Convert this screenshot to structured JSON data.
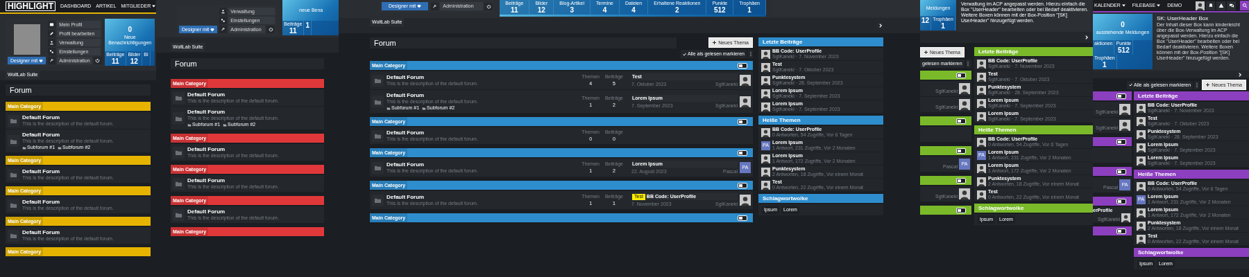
{
  "panels": [
    {
      "kind": "left",
      "color": "#e6b400",
      "header": {
        "logo": "HIGHLIGHT",
        "nav": [
          {
            "label": "DASHBOARD",
            "dropdown": false
          },
          {
            "label": "ARTIKEL",
            "dropdown": false
          },
          {
            "label": "MITGLIEDER",
            "dropdown": true
          }
        ]
      },
      "user": {
        "button": "Designer mit",
        "menu": [
          {
            "label": "Mein Profil",
            "kind": "profile"
          },
          {
            "label": "Profil bearbeiten",
            "kind": "edit"
          },
          {
            "label": "Verwaltung",
            "kind": "account"
          },
          {
            "label": "Einstellungen",
            "kind": "settings"
          },
          {
            "label": "Administration",
            "kind": "admin"
          }
        ]
      },
      "stats": {
        "counter": "0",
        "counter_label": "Neue Benachrichtigungen",
        "items": [
          {
            "label": "Beiträge",
            "value": "11"
          },
          {
            "label": "Bilder",
            "value": "12"
          },
          {
            "label": "Bl"
          }
        ]
      },
      "breadcrumb": "WoltLab Suite",
      "title": "Forum",
      "categories": [
        {
          "title": "Main Category",
          "forums": [
            {
              "kind": "full",
              "title": "Default Forum",
              "description": "This is the description of the default forum."
            },
            {
              "kind": "full",
              "title": "Default Forum",
              "description": "This is the description of the default forum.",
              "subforums": [
                "Subforum #1",
                "Subforum #2"
              ]
            }
          ]
        },
        {
          "title": "Main Category",
          "forums": [
            {
              "kind": "full",
              "title": "Default Forum",
              "description": "This is the description of the default forum."
            }
          ]
        },
        {
          "title": "Main Category",
          "forums": [
            {
              "kind": "full",
              "title": "Default Forum",
              "description": "This is the description of the default forum."
            }
          ]
        },
        {
          "title": "Main Category",
          "forums": [
            {
              "kind": "full",
              "title": "Default Forum",
              "description": "This is the description of the default forum."
            }
          ]
        },
        {
          "title": "Main Category"
        }
      ]
    },
    {
      "kind": "second",
      "color": "#e0383a",
      "user": {
        "button": "Designer mit",
        "menu": [
          {
            "label": "Verwaltung",
            "kind": "account"
          },
          {
            "label": "Einstellungen",
            "kind": "settings"
          },
          {
            "label": "Administration",
            "kind": "admin"
          }
        ]
      },
      "stats": {
        "counter_label": "neue Bena",
        "items": [
          {
            "label": "Beiträge",
            "value": "11"
          },
          {
            "value": "1"
          }
        ]
      },
      "breadcrumb": "WoltLab Suite",
      "title": "Forum",
      "categories": [
        {
          "title": "Main Category",
          "forums": [
            {
              "kind": "full",
              "title": "Default Forum",
              "description": "This is the description of the default forum."
            },
            {
              "kind": "full",
              "title": "Default Forum",
              "description": "This is the description of the default forum.",
              "subforums": [
                "Subforum #1",
                "Subforum #2"
              ]
            }
          ]
        },
        {
          "title": "Main Category",
          "forums": [
            {
              "kind": "full",
              "title": "Default Forum",
              "description": "This is the description of the default forum."
            }
          ]
        },
        {
          "title": "Main Category",
          "forums": [
            {
              "kind": "full",
              "title": "Default Forum",
              "description": "This is the description of the default forum."
            }
          ]
        },
        {
          "title": "Main Category",
          "forums": [
            {
              "kind": "full",
              "title": "Default Forum",
              "description": "This is the description of the default forum."
            }
          ]
        },
        {
          "title": "Main Category"
        }
      ]
    },
    {
      "kind": "center",
      "color": "#2e8dcd",
      "user": {
        "button": "Designer mit",
        "menu": [
          {
            "label": "Administration",
            "kind": "admin"
          }
        ]
      },
      "stats": {
        "items": [
          {
            "label": "Beiträge",
            "value": "11"
          },
          {
            "label": "Bilder",
            "value": "12"
          },
          {
            "label": "Blog-Artikel",
            "value": "3"
          },
          {
            "label": "Termine",
            "value": "4"
          },
          {
            "label": "Dateien",
            "value": "4"
          },
          {
            "label": "Erhaltene Reaktionen",
            "value": "2"
          },
          {
            "label": "Punkte",
            "value": "512"
          },
          {
            "label": "Trophäen",
            "value": "1"
          }
        ]
      },
      "breadcrumb": "WoltLab Suite",
      "title": "Forum",
      "new_thread": "Neues Thema",
      "mark_read": "Alle als gelesen markieren",
      "categories": [
        {
          "title": "Main Category",
          "toggle": true,
          "forums": [
            {
              "kind": "full",
              "title": "Default Forum",
              "description": "This is the description of the default forum.",
              "stats": [
                {
                  "label": "Themen",
                  "value": "4"
                },
                {
                  "label": "Beiträge",
                  "value": "5"
                }
              ],
              "last_post": {
                "title": "Test",
                "date": "7. Oktober 2023",
                "author": "SgtKaneki",
                "avatar": {
                  "kind": "photo"
                }
              }
            },
            {
              "kind": "full",
              "title": "Default Forum",
              "description": "This is the description of the default forum.",
              "subforums": [
                "Subforum #1",
                "Subforum #2"
              ],
              "stats": [
                {
                  "label": "Themen",
                  "value": "1"
                },
                {
                  "label": "Beiträge",
                  "value": "2"
                }
              ],
              "last_post": {
                "title": "Lorem Ipsum",
                "date": "7. September 2023",
                "author": "SgtKaneki",
                "avatar": {
                  "kind": "photo"
                }
              }
            }
          ]
        },
        {
          "title": "Main Category",
          "toggle": true,
          "forums": [
            {
              "kind": "full",
              "title": "Default Forum",
              "description": "This is the description of the default forum.",
              "stats": [
                {
                  "label": "Themen",
                  "value": "0"
                },
                {
                  "label": "Beiträge",
                  "value": "0"
                }
              ]
            }
          ]
        },
        {
          "title": "Main Category",
          "toggle": true,
          "forums": [
            {
              "kind": "full",
              "title": "Default Forum",
              "description": "This is the description of the default forum.",
              "stats": [
                {
                  "label": "Themen",
                  "value": "1"
                },
                {
                  "label": "Beiträge",
                  "value": "2"
                }
              ],
              "last_post": {
                "title": "Lorem Ipsum",
                "date": "22. August 2023",
                "author": "Pascal",
                "avatar": {
                  "kind": "initials",
                  "text": "PA"
                }
              }
            }
          ]
        },
        {
          "title": "Main Category",
          "toggle": true,
          "forums": [
            {
              "kind": "full",
              "title": "Default Forum",
              "description": "This is the description of the default forum.",
              "stats": [
                {
                  "label": "Themen",
                  "value": "1"
                },
                {
                  "label": "Beiträge",
                  "value": "1"
                }
              ],
              "last_post": {
                "prefix": "Test",
                "title": "BB Code: UserProfile",
                "date": "7. November 2023",
                "author": "SgtKaneki",
                "avatar": {
                  "kind": "photo"
                }
              }
            }
          ]
        },
        {
          "title": "Main Category",
          "toggle": true
        }
      ],
      "sidebar": [
        {
          "kind": "posts",
          "title": "Letzte Beiträge",
          "items": [
            {
              "title": "BB Code: UserProfile",
              "meta": "SgtKaneki · 7. November 2023",
              "avatar": {
                "kind": "photo"
              }
            },
            {
              "title": "Test",
              "meta": "SgtKaneki · 7. Oktober 2023",
              "avatar": {
                "kind": "photo"
              }
            },
            {
              "title": "Punktesystem",
              "meta": "SgtKaneki · 28. September 2023",
              "avatar": {
                "kind": "photo"
              }
            },
            {
              "title": "Lorem Ipsum",
              "meta": "SgtKaneki · 7. September 2023",
              "avatar": {
                "kind": "photo"
              }
            },
            {
              "title": "Lorem Ipsum",
              "meta": "SgtKaneki · 7. September 2023",
              "avatar": {
                "kind": "photo"
              }
            }
          ]
        },
        {
          "kind": "posts",
          "title": "Heiße Themen",
          "items": [
            {
              "title": "BB Code: UserProfile",
              "meta": "0 Antworten, 54 Zugriffe, Vor 6 Tagen",
              "avatar": {
                "kind": "photo"
              }
            },
            {
              "title": "Lorem Ipsum",
              "meta": "1 Antwort, 231 Zugriffe, Vor 2 Monaten",
              "avatar": {
                "kind": "initials",
                "text": "PA"
              }
            },
            {
              "title": "Lorem Ipsum",
              "meta": "1 Antwort, 172 Zugriffe, Vor 2 Monaten",
              "avatar": {
                "kind": "photo"
              }
            },
            {
              "title": "Punktesystem",
              "meta": "2 Antworten, 18 Zugriffe, Vor einem Monat",
              "avatar": {
                "kind": "photo"
              }
            },
            {
              "title": "Test",
              "meta": "0 Antworten, 22 Zugriffe, Vor einem Monat",
              "avatar": {
                "kind": "photo"
              }
            }
          ]
        },
        {
          "kind": "tags",
          "title": "Schlagwortwolke",
          "tags": [
            "Ipsum",
            "Lorem"
          ]
        }
      ]
    },
    {
      "kind": "fourth",
      "color": "#7aba2a",
      "stats": {
        "counter_label": "Meldungen",
        "items": [
          {
            "value": "12"
          },
          {
            "label": "Trophäen",
            "value": "1"
          }
        ]
      },
      "info": {
        "text": "Verwaltung im ACP angepasst werden. Hierzu einfach die Box \"UserHeader\" bearbeiten oder bei Bedarf deaktivieren. Weitere Boxen können mit der Box-Position \"[SK] UserHeader\" hinzugefügt werden."
      },
      "new_thread": "Neues Thema",
      "mark_read": "gelesen markieren",
      "categories": [
        {
          "toggle": true,
          "forums": [
            {
              "kind": "tail",
              "author": "SgtKaneki",
              "avatar": {
                "kind": "photo"
              }
            },
            {
              "kind": "tail",
              "author": "SgtKaneki",
              "avatar": {
                "kind": "photo"
              }
            }
          ]
        },
        {
          "toggle": true,
          "forums": [
            {
              "kind": "empty"
            }
          ]
        },
        {
          "toggle": true,
          "forums": [
            {
              "kind": "tail",
              "author": "Pascal",
              "avatar": {
                "kind": "initials",
                "text": "PA"
              }
            }
          ]
        },
        {
          "toggle": true,
          "forums": [
            {
              "kind": "tail",
              "author": "SgtKaneki",
              "avatar": {
                "kind": "photo"
              }
            }
          ]
        },
        {
          "toggle": true
        }
      ],
      "sidebar": [
        {
          "kind": "posts",
          "title": "Letzte Beiträge",
          "items": [
            {
              "title": "BB Code: UserProfile",
              "meta": "SgtKaneki · 7. November 2023",
              "avatar": {
                "kind": "photo"
              }
            },
            {
              "title": "Test",
              "meta": "SgtKaneki · 7. Oktober 2023",
              "avatar": {
                "kind": "photo"
              }
            },
            {
              "title": "Punktesystem",
              "meta": "SgtKaneki · 28. September 2023",
              "avatar": {
                "kind": "photo"
              }
            },
            {
              "title": "Lorem Ipsum",
              "meta": "SgtKaneki · 7. September 2023",
              "avatar": {
                "kind": "photo"
              }
            },
            {
              "title": "Lorem Ipsum",
              "meta": "SgtKaneki · 7. September 2023",
              "avatar": {
                "kind": "photo"
              }
            }
          ]
        },
        {
          "kind": "posts",
          "title": "Heiße Themen",
          "items": [
            {
              "title": "BB Code: UserProfile",
              "meta": "0 Antworten, 54 Zugriffe, Vor 6 Tagen",
              "avatar": {
                "kind": "photo"
              }
            },
            {
              "title": "Lorem Ipsum",
              "meta": "1 Antwort, 231 Zugriffe, Vor 2 Monaten",
              "avatar": {
                "kind": "initials",
                "text": "PA"
              }
            },
            {
              "title": "Lorem Ipsum",
              "meta": "1 Antwort, 172 Zugriffe, Vor 2 Monaten",
              "avatar": {
                "kind": "photo"
              }
            },
            {
              "title": "Punktesystem",
              "meta": "2 Antworten, 18 Zugriffe, Vor einem Monat",
              "avatar": {
                "kind": "photo"
              }
            },
            {
              "title": "Test",
              "meta": "0 Antworten, 22 Zugriffe, Vor einem Monat",
              "avatar": {
                "kind": "photo"
              }
            }
          ]
        },
        {
          "kind": "tags",
          "title": "Schlagwortwolke",
          "tags": [
            "Ipsum",
            "Lorem"
          ]
        }
      ]
    },
    {
      "kind": "right",
      "color": "#8c3fbf",
      "header": {
        "nav": [
          {
            "label": "KALENDER",
            "dropdown": true
          },
          {
            "label": "FILEBASE",
            "dropdown": true
          },
          {
            "label": "DEMO",
            "dropdown": false
          }
        ]
      },
      "stats": {
        "counter": "0",
        "counter_label": "ausstehende Meldungen",
        "items": [
          {
            "label": "aktionen"
          },
          {
            "label": "Punkte",
            "value": "512"
          },
          {
            "label": "Trophäen",
            "value": "1"
          }
        ]
      },
      "info": {
        "title": "SK: UserHeader Box",
        "text": "Der Inhalt dieser Box kann kinderleicht über die Box-Verwaltung im ACP angepasst werden. Hierzu einfach die Box \"UserHeader\" bearbeiten oder bei Bedarf deaktivieren. Weitere Boxen können mit der Box-Position \"[SK] UserHeader\" hinzugefügt werden."
      },
      "new_thread": "Neues Thema",
      "mark_read": "Alle als gelesen markieren",
      "categories": [
        {
          "toggle": true,
          "forums": [
            {
              "kind": "tail",
              "author": "SgtKaneki",
              "avatar": {
                "kind": "photo"
              }
            },
            {
              "kind": "tail",
              "author": "SgtKaneki",
              "avatar": {
                "kind": "photo"
              }
            }
          ]
        },
        {
          "toggle": true,
          "forums": [
            {
              "kind": "empty"
            }
          ]
        },
        {
          "toggle": true,
          "forums": [
            {
              "kind": "tail",
              "author": "Pascal",
              "avatar": {
                "kind": "initials",
                "text": "PA"
              }
            }
          ]
        },
        {
          "toggle": true,
          "forums": [
            {
              "kind": "tail",
              "title": "erProfile",
              "author": "SgtKaneki",
              "avatar": {
                "kind": "photo"
              }
            }
          ]
        },
        {
          "toggle": true
        }
      ],
      "sidebar": [
        {
          "kind": "posts",
          "title": "Letzte Beiträge",
          "items": [
            {
              "title": "BB Code: UserProfile",
              "meta": "SgtKaneki · 7. November 2023",
              "avatar": {
                "kind": "photo"
              }
            },
            {
              "title": "Test",
              "meta": "SgtKaneki · 7. Oktober 2023",
              "avatar": {
                "kind": "photo"
              }
            },
            {
              "title": "Punktesystem",
              "meta": "SgtKaneki · 28. September 2023",
              "avatar": {
                "kind": "photo"
              }
            },
            {
              "title": "Lorem Ipsum",
              "meta": "SgtKaneki · 7. September 2023",
              "avatar": {
                "kind": "photo"
              }
            },
            {
              "title": "Lorem Ipsum",
              "meta": "SgtKaneki · 7. September 2023",
              "avatar": {
                "kind": "photo"
              }
            }
          ]
        },
        {
          "kind": "posts",
          "title": "Heiße Themen",
          "items": [
            {
              "title": "BB Code: UserProfile",
              "meta": "0 Antworten, 54 Zugriffe, Vor 6 Tagen",
              "avatar": {
                "kind": "photo"
              }
            },
            {
              "title": "Lorem Ipsum",
              "meta": "1 Antwort, 231 Zugriffe, Vor 2 Monaten",
              "avatar": {
                "kind": "initials",
                "text": "PA"
              }
            },
            {
              "title": "Lorem Ipsum",
              "meta": "1 Antwort, 172 Zugriffe, Vor 2 Monaten",
              "avatar": {
                "kind": "photo"
              }
            },
            {
              "title": "Punktesystem",
              "meta": "2 Antworten, 18 Zugriffe, Vor einem Monat",
              "avatar": {
                "kind": "photo"
              }
            },
            {
              "title": "Test",
              "meta": "0 Antworten, 22 Zugriffe, Vor einem Monat",
              "avatar": {
                "kind": "photo"
              }
            }
          ]
        },
        {
          "kind": "tags",
          "title": "Schlagwortwolke",
          "tags": [
            "Ipsum",
            "Lorem"
          ]
        }
      ]
    }
  ]
}
